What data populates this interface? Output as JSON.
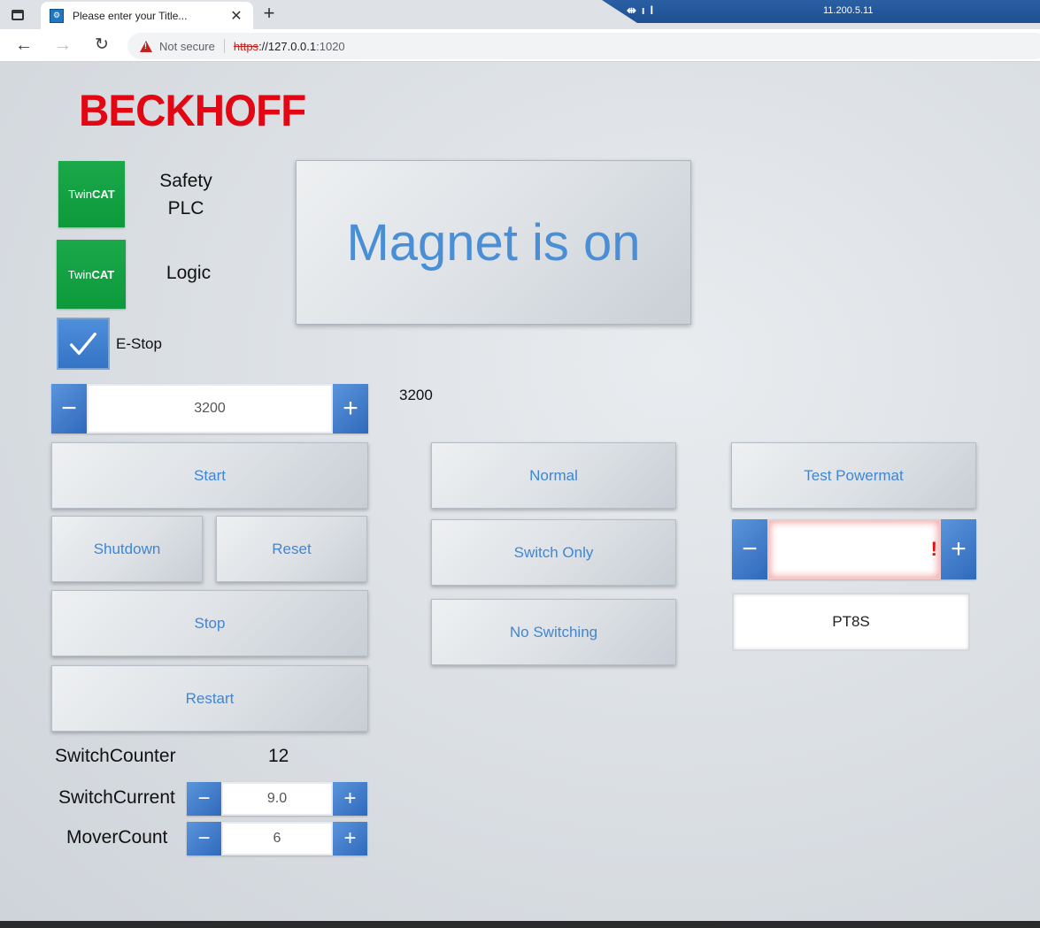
{
  "browser": {
    "tab_title": "Please enter your Title...",
    "not_secure": "Not secure",
    "url_scheme": "https",
    "url_host": "://127.0.0.1",
    "url_port": ":1020",
    "remote_ip": "11.200.5.11"
  },
  "brand": {
    "logo_text": "BECKHOFF",
    "logo_color": "#e30613",
    "twincat_badge": "TwinCAT",
    "twincat_color": "#1aa84a"
  },
  "status": {
    "safety_label_line1": "Safety",
    "safety_label_line2": "PLC",
    "logic_label": "Logic",
    "magnet_message": "Magnet is on",
    "estop_label": "E-Stop",
    "estop_checked": true
  },
  "setpoint": {
    "value": "3200",
    "readout": "3200"
  },
  "controls": {
    "start": "Start",
    "shutdown": "Shutdown",
    "reset": "Reset",
    "stop": "Stop",
    "restart": "Restart"
  },
  "modes": {
    "normal": "Normal",
    "switch_only": "Switch Only",
    "no_switching": "No Switching"
  },
  "powermat": {
    "test_label": "Test Powermat",
    "input_value": "",
    "error_mark": "!",
    "duration": "PT8S"
  },
  "stats": {
    "switch_counter_label": "SwitchCounter",
    "switch_counter_value": "12",
    "switch_current_label": "SwitchCurrent",
    "switch_current_value": "9.0",
    "mover_count_label": "MoverCount",
    "mover_count_value": "6"
  },
  "colors": {
    "accent_blue": "#3f86d4",
    "stepper_blue": "#2f69bb",
    "error_red": "#e01010"
  }
}
